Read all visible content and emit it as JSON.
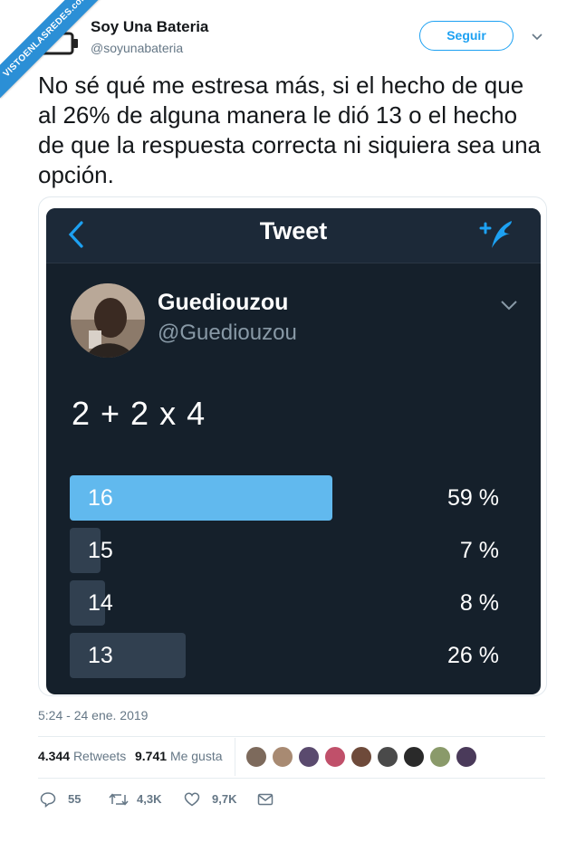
{
  "watermark": {
    "text": "VISTOENLASREDES.com"
  },
  "author": {
    "name": "Soy Una Bateria",
    "handle": "@soyunabateria",
    "avatar_icon": "battery-icon"
  },
  "follow_button": {
    "label": "Seguir"
  },
  "tweet": {
    "text": "No sé qué me estresa más, si el hecho de que al 26% de alguna manera le dió 13 o el hecho de que la respuesta correcta ni siquiera sea una opción."
  },
  "embedded_screenshot": {
    "title": "Tweet",
    "user": {
      "name": "Guediouzou",
      "handle": "@Guediouzou"
    },
    "question": "2 + 2 x 4",
    "poll": [
      {
        "label": "16",
        "percent_text": "59 %",
        "fraction": 0.59,
        "winner": true
      },
      {
        "label": "15",
        "percent_text": "7 %",
        "fraction": 0.07,
        "winner": false
      },
      {
        "label": "14",
        "percent_text": "8 %",
        "fraction": 0.08,
        "winner": false
      },
      {
        "label": "13",
        "percent_text": "26 %",
        "fraction": 0.26,
        "winner": false
      }
    ],
    "colors": {
      "background": "#15202b",
      "winner_bar": "#61b9ee",
      "bar": "#314050"
    }
  },
  "timestamp": "5:24 - 24 ene. 2019",
  "stats": {
    "retweets_count": "4.344",
    "retweets_label": "Retweets",
    "likes_count": "9.741",
    "likes_label": "Me gusta"
  },
  "actions": {
    "replies": "55",
    "retweets": "4,3K",
    "likes": "9,7K"
  },
  "colors": {
    "accent": "#1da1f2",
    "secondary_text": "#657786"
  }
}
